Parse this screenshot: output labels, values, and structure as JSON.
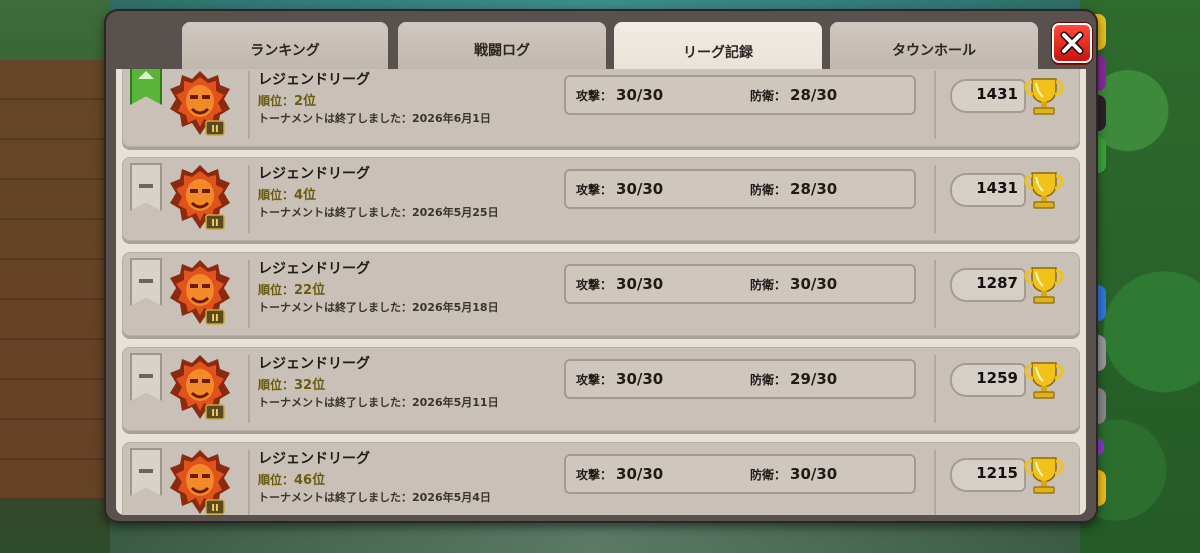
{
  "tabs": [
    {
      "label": "ランキング"
    },
    {
      "label": "戦闘ログ"
    },
    {
      "label": "リーグ記録",
      "active": true
    },
    {
      "label": "タウンホール"
    }
  ],
  "close_label": "X",
  "rows": [
    {
      "league": "レジェンドリーグ",
      "rank_label": "順位：",
      "rank": "2位",
      "ended": "トーナメントは終了しました：2026年6月1日",
      "attack_label": "攻撃：",
      "attack": "30/30",
      "defense_label": "防衛：",
      "defense": "28/30",
      "trophies": "1431",
      "banner": "up",
      "badge_level": "II"
    },
    {
      "league": "レジェンドリーグ",
      "rank_label": "順位：",
      "rank": "4位",
      "ended": "トーナメントは終了しました：2026年5月25日",
      "attack_label": "攻撃：",
      "attack": "30/30",
      "defense_label": "防衛：",
      "defense": "28/30",
      "trophies": "1431",
      "banner": "same",
      "badge_level": "II"
    },
    {
      "league": "レジェンドリーグ",
      "rank_label": "順位：",
      "rank": "22位",
      "ended": "トーナメントは終了しました：2026年5月18日",
      "attack_label": "攻撃：",
      "attack": "30/30",
      "defense_label": "防衛：",
      "defense": "30/30",
      "trophies": "1287",
      "banner": "same",
      "badge_level": "II"
    },
    {
      "league": "レジェンドリーグ",
      "rank_label": "順位：",
      "rank": "32位",
      "ended": "トーナメントは終了しました：2026年5月11日",
      "attack_label": "攻撃：",
      "attack": "30/30",
      "defense_label": "防衛：",
      "defense": "29/30",
      "trophies": "1259",
      "banner": "same",
      "badge_level": "II"
    },
    {
      "league": "レジェンドリーグ",
      "rank_label": "順位：",
      "rank": "46位",
      "ended": "トーナメントは終了しました：2026年5月4日",
      "attack_label": "攻撃：",
      "attack": "30/30",
      "defense_label": "防衛：",
      "defense": "30/30",
      "trophies": "1215",
      "banner": "same",
      "badge_level": "II"
    }
  ],
  "colors": {
    "banner_up": "#59b43a",
    "close_red": "#e0261c",
    "trophy_gold": "#f2c21a"
  }
}
